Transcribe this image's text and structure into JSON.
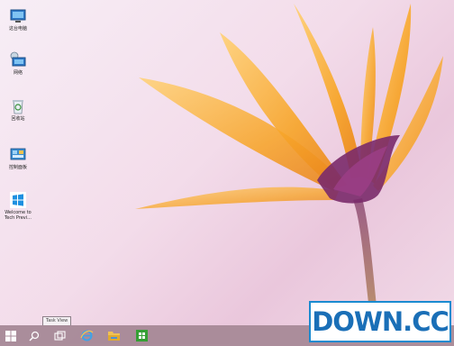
{
  "desktop": {
    "icons": [
      {
        "label": "这台电脑",
        "icon": "computer-icon"
      },
      {
        "label": "网络",
        "icon": "network-icon"
      },
      {
        "label": "回收站",
        "icon": "recycle-bin-icon"
      },
      {
        "label": "控制面板",
        "icon": "control-panel-icon"
      },
      {
        "label": "Welcome to\nTech Previ...",
        "icon": "windows-logo-icon"
      }
    ]
  },
  "taskbar": {
    "tooltip": "Task View",
    "buttons": [
      "start-button",
      "search-button",
      "task-view-button",
      "internet-explorer-button",
      "file-explorer-button",
      "store-button"
    ]
  },
  "watermark": {
    "text": "DOWN.CC"
  },
  "colors": {
    "taskbar": "#a88a98",
    "petal": "#f6a623",
    "flower_center": "#7a2a6a",
    "accent_blue": "#1a6fb7"
  }
}
